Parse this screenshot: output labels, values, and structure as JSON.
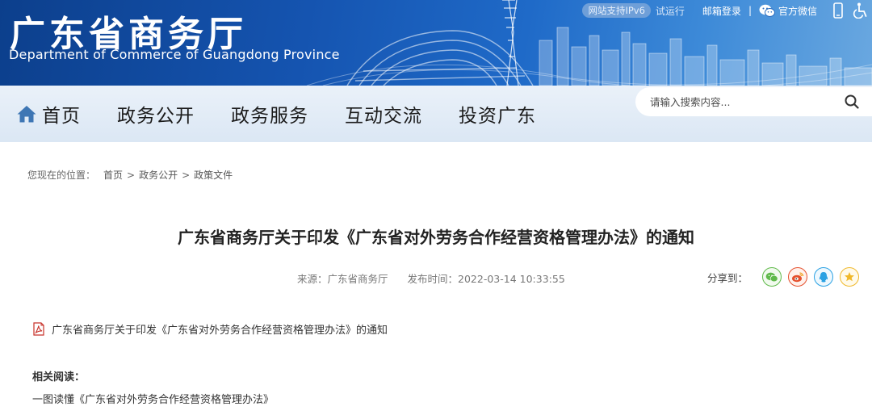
{
  "header": {
    "title": "广东省商务厅",
    "subtitle": "Department of Commerce of Guangdong Province",
    "ipv6_badge": "网站支持IPv6",
    "trial_label": "试运行",
    "mail_login": "邮箱登录",
    "separator": "|",
    "wechat": "官方微信",
    "icons": [
      "wechat-icon",
      "mobile-icon",
      "accessibility-icon"
    ]
  },
  "nav": {
    "home": "首页",
    "items": [
      "政务公开",
      "政务服务",
      "互动交流",
      "投资广东"
    ],
    "search_placeholder": "请输入搜索内容..."
  },
  "breadcrumb": {
    "label": "您现在的位置：",
    "items": [
      "首页",
      "政务公开",
      "政策文件"
    ],
    "separator": ">"
  },
  "article": {
    "title": "广东省商务厅关于印发《广东省对外劳务合作经营资格管理办法》的通知",
    "source": "来源：广东省商务厅",
    "published": "发布时间：2022-03-14 10:33:55",
    "share_label": "分享到：",
    "share_targets": [
      "wechat",
      "weibo",
      "qq",
      "qzone"
    ],
    "attachment": "广东省商务厅关于印发《广东省对外劳务合作经营资格管理办法》的通知",
    "related_heading": "相关阅读：",
    "related_items": [
      "一图读懂《广东省对外劳务合作经营资格管理办法》"
    ]
  },
  "colors": {
    "banner_dark": "#0c3f8c",
    "banner_light": "#6aa8e0",
    "nav_bg": "#e3edf7",
    "home_icon": "#3e76b4"
  }
}
